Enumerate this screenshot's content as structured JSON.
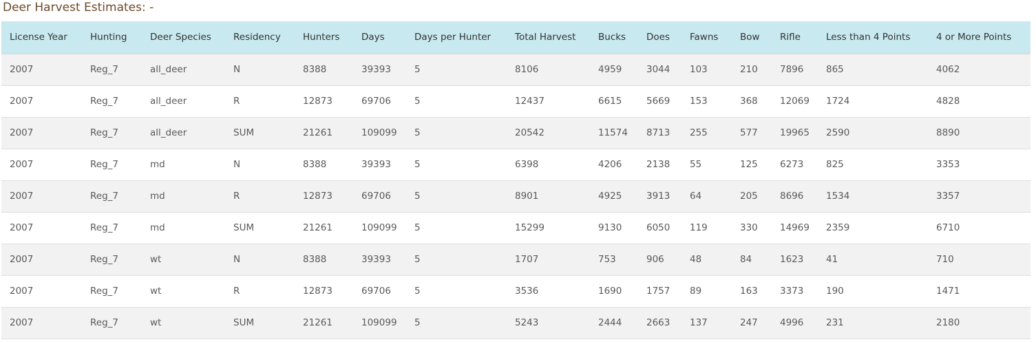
{
  "page": {
    "title": "Deer Harvest Estimates: -"
  },
  "table": {
    "headers": [
      "License Year",
      "Hunting",
      "Deer Species",
      "Residency",
      "Hunters",
      "Days",
      "Days per Hunter",
      "Total Harvest",
      "Bucks",
      "Does",
      "Fawns",
      "Bow",
      "Rifle",
      "Less than 4 Points",
      "4 or More Points"
    ],
    "rows": [
      [
        "2007",
        "Reg_7",
        "all_deer",
        "N",
        "8388",
        "39393",
        "5",
        "8106",
        "4959",
        "3044",
        "103",
        "210",
        "7896",
        "865",
        "4062"
      ],
      [
        "2007",
        "Reg_7",
        "all_deer",
        "R",
        "12873",
        "69706",
        "5",
        "12437",
        "6615",
        "5669",
        "153",
        "368",
        "12069",
        "1724",
        "4828"
      ],
      [
        "2007",
        "Reg_7",
        "all_deer",
        "SUM",
        "21261",
        "109099",
        "5",
        "20542",
        "11574",
        "8713",
        "255",
        "577",
        "19965",
        "2590",
        "8890"
      ],
      [
        "2007",
        "Reg_7",
        "md",
        "N",
        "8388",
        "39393",
        "5",
        "6398",
        "4206",
        "2138",
        "55",
        "125",
        "6273",
        "825",
        "3353"
      ],
      [
        "2007",
        "Reg_7",
        "md",
        "R",
        "12873",
        "69706",
        "5",
        "8901",
        "4925",
        "3913",
        "64",
        "205",
        "8696",
        "1534",
        "3357"
      ],
      [
        "2007",
        "Reg_7",
        "md",
        "SUM",
        "21261",
        "109099",
        "5",
        "15299",
        "9130",
        "6050",
        "119",
        "330",
        "14969",
        "2359",
        "6710"
      ],
      [
        "2007",
        "Reg_7",
        "wt",
        "N",
        "8388",
        "39393",
        "5",
        "1707",
        "753",
        "906",
        "48",
        "84",
        "1623",
        "41",
        "710"
      ],
      [
        "2007",
        "Reg_7",
        "wt",
        "R",
        "12873",
        "69706",
        "5",
        "3536",
        "1690",
        "1757",
        "89",
        "163",
        "3373",
        "190",
        "1471"
      ],
      [
        "2007",
        "Reg_7",
        "wt",
        "SUM",
        "21261",
        "109099",
        "5",
        "5243",
        "2444",
        "2663",
        "137",
        "247",
        "4996",
        "231",
        "2180"
      ]
    ]
  }
}
